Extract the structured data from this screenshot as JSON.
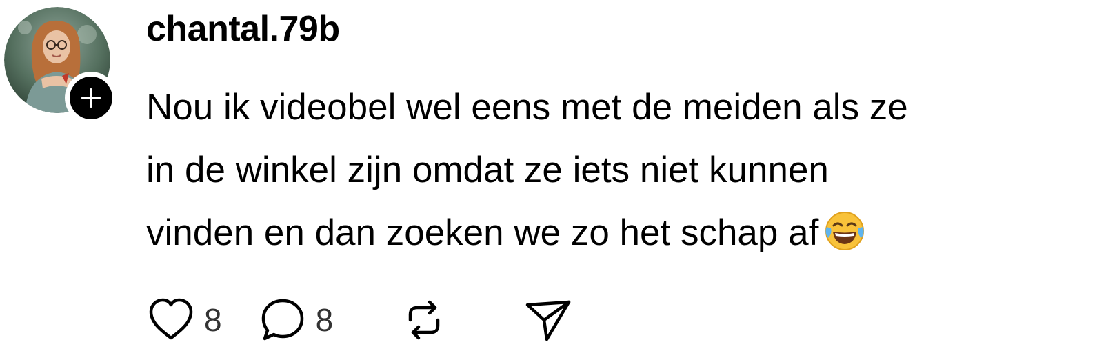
{
  "post": {
    "username": "chantal.79b",
    "text_lines": [
      "Nou ik videobel wel eens met de meiden als ze",
      "in de winkel zijn omdat ze iets niet kunnen",
      "vinden en dan zoeken we zo het schap af"
    ],
    "emoji": "face-with-tears-of-joy",
    "avatar_icon": "avatar-photo",
    "follow_icon": "plus-icon"
  },
  "actions": {
    "like": {
      "icon": "heart-icon",
      "count": "8"
    },
    "reply": {
      "icon": "comment-icon",
      "count": "8"
    },
    "repost": {
      "icon": "repost-icon"
    },
    "share": {
      "icon": "send-icon"
    }
  },
  "colors": {
    "text": "#000000",
    "count": "#333333",
    "badge": "#000000",
    "background": "#ffffff"
  }
}
